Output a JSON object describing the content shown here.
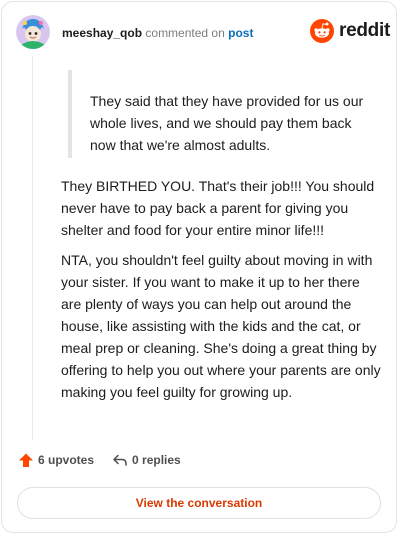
{
  "header": {
    "username": "meeshay_qob",
    "action_text": "commented on",
    "post_link": "post",
    "brand": "reddit"
  },
  "comment": {
    "quote": "They said that they have provided for us our whole lives, and we should pay them back now that we're almost adults.",
    "paragraphs": [
      "They BIRTHED YOU. That's their job!!! You should never have to pay back a parent for giving you shelter and food for your entire minor life!!!",
      "NTA, you shouldn't feel guilty about moving in with your sister. If you want to make it up to her there are plenty of ways you can help out around the house, like assisting with the kids and the cat, or meal prep or cleaning. She's doing a great thing by offering to help you out where your parents are only making you feel guilty for growing up."
    ]
  },
  "footer": {
    "upvotes_label": "6 upvotes",
    "replies_label": "0 replies",
    "view_button": "View the conversation"
  },
  "icons": {
    "upvote": "upvote-arrow-icon",
    "reply": "reply-arrow-icon",
    "logo": "reddit-snoo-icon"
  },
  "colors": {
    "accent": "#d93a00",
    "upvote": "#ff4500",
    "link": "#0a6fb5",
    "muted": "#7c7c7c"
  }
}
